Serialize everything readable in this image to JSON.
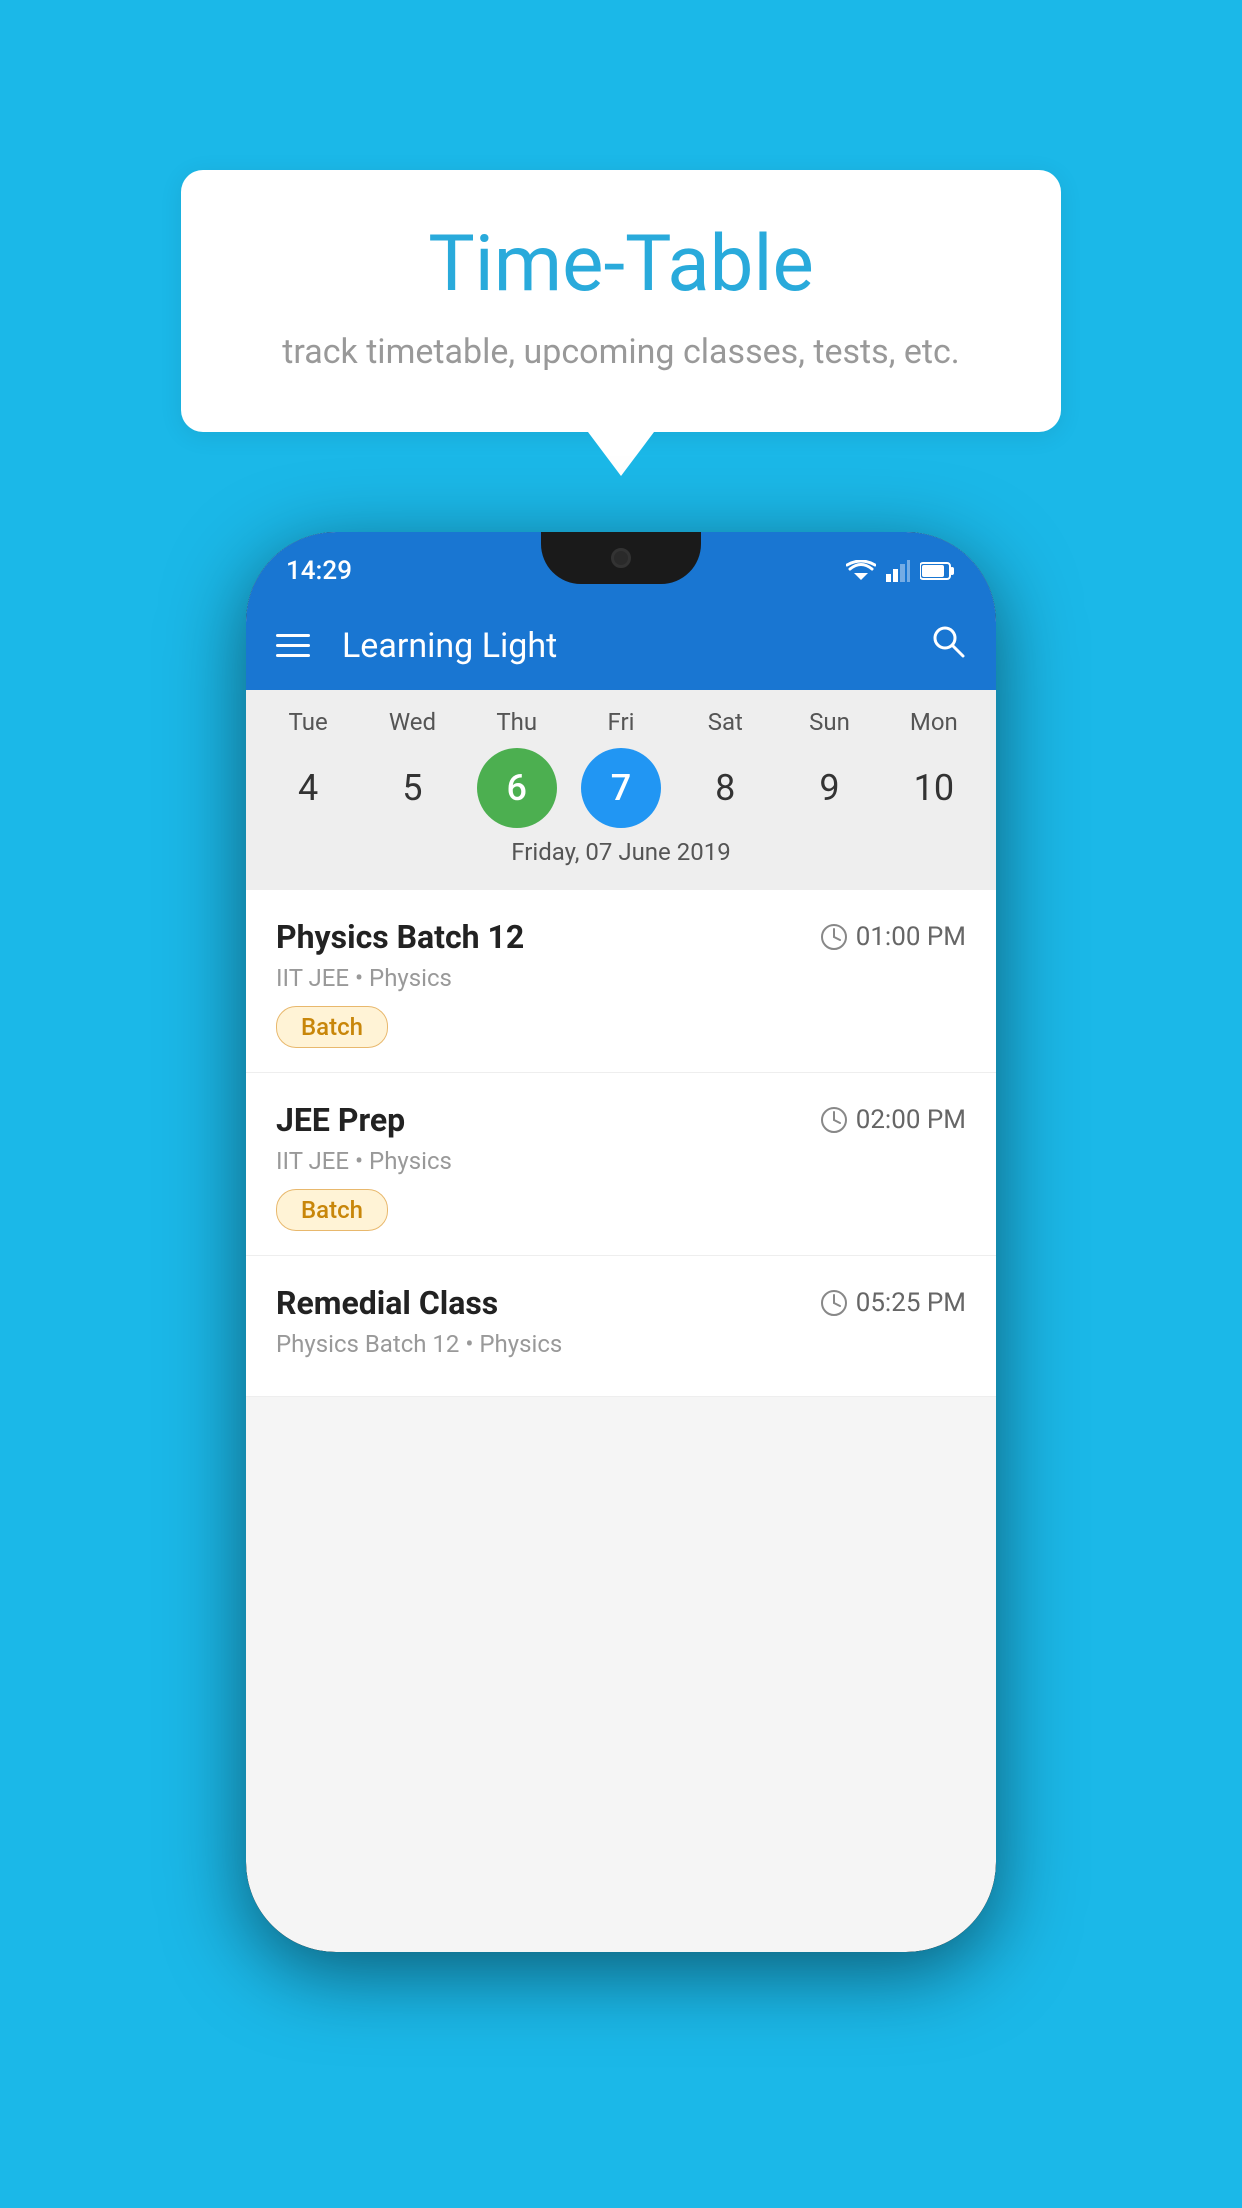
{
  "page": {
    "background_color": "#1BB8E8"
  },
  "tooltip": {
    "title": "Time-Table",
    "subtitle": "track timetable, upcoming classes, tests, etc."
  },
  "phone": {
    "status_bar": {
      "time": "14:29"
    },
    "app_bar": {
      "title": "Learning Light"
    },
    "calendar": {
      "day_headers": [
        "Tue",
        "Wed",
        "Thu",
        "Fri",
        "Sat",
        "Sun",
        "Mon"
      ],
      "day_numbers": [
        4,
        5,
        6,
        7,
        8,
        9,
        10
      ],
      "today_index": 2,
      "selected_index": 3,
      "selected_date_label": "Friday, 07 June 2019"
    },
    "schedule_items": [
      {
        "title": "Physics Batch 12",
        "time": "01:00 PM",
        "meta": "IIT JEE • Physics",
        "badge": "Batch"
      },
      {
        "title": "JEE Prep",
        "time": "02:00 PM",
        "meta": "IIT JEE • Physics",
        "badge": "Batch"
      },
      {
        "title": "Remedial Class",
        "time": "05:25 PM",
        "meta": "Physics Batch 12 • Physics",
        "badge": null
      }
    ]
  },
  "icons": {
    "hamburger": "☰",
    "search": "🔍",
    "clock": "⏱"
  }
}
